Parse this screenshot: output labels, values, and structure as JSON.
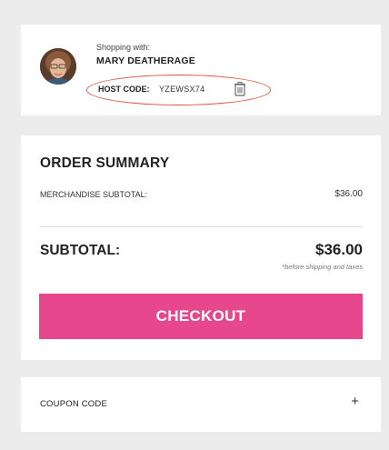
{
  "host": {
    "shopping_with_label": "Shopping with:",
    "name": "MARY DEATHERAGE",
    "code_label": "HOST CODE:",
    "code_value": "YZEWSX74",
    "remove_icon": "trash-icon"
  },
  "summary": {
    "title": "ORDER SUMMARY",
    "merchandise_label": "MERCHANDISE SUBTOTAL:",
    "merchandise_value": "$36.00",
    "subtotal_label": "SUBTOTAL:",
    "subtotal_value": "$36.00",
    "subtotal_note": "*before shipping and taxes",
    "checkout_label": "CHECKOUT"
  },
  "coupon": {
    "label": "COUPON CODE",
    "expand_icon": "plus-icon",
    "expand_glyph": "+"
  },
  "colors": {
    "accent": "#e6478d",
    "highlight_ellipse": "#e0533a",
    "background": "#ececec"
  }
}
